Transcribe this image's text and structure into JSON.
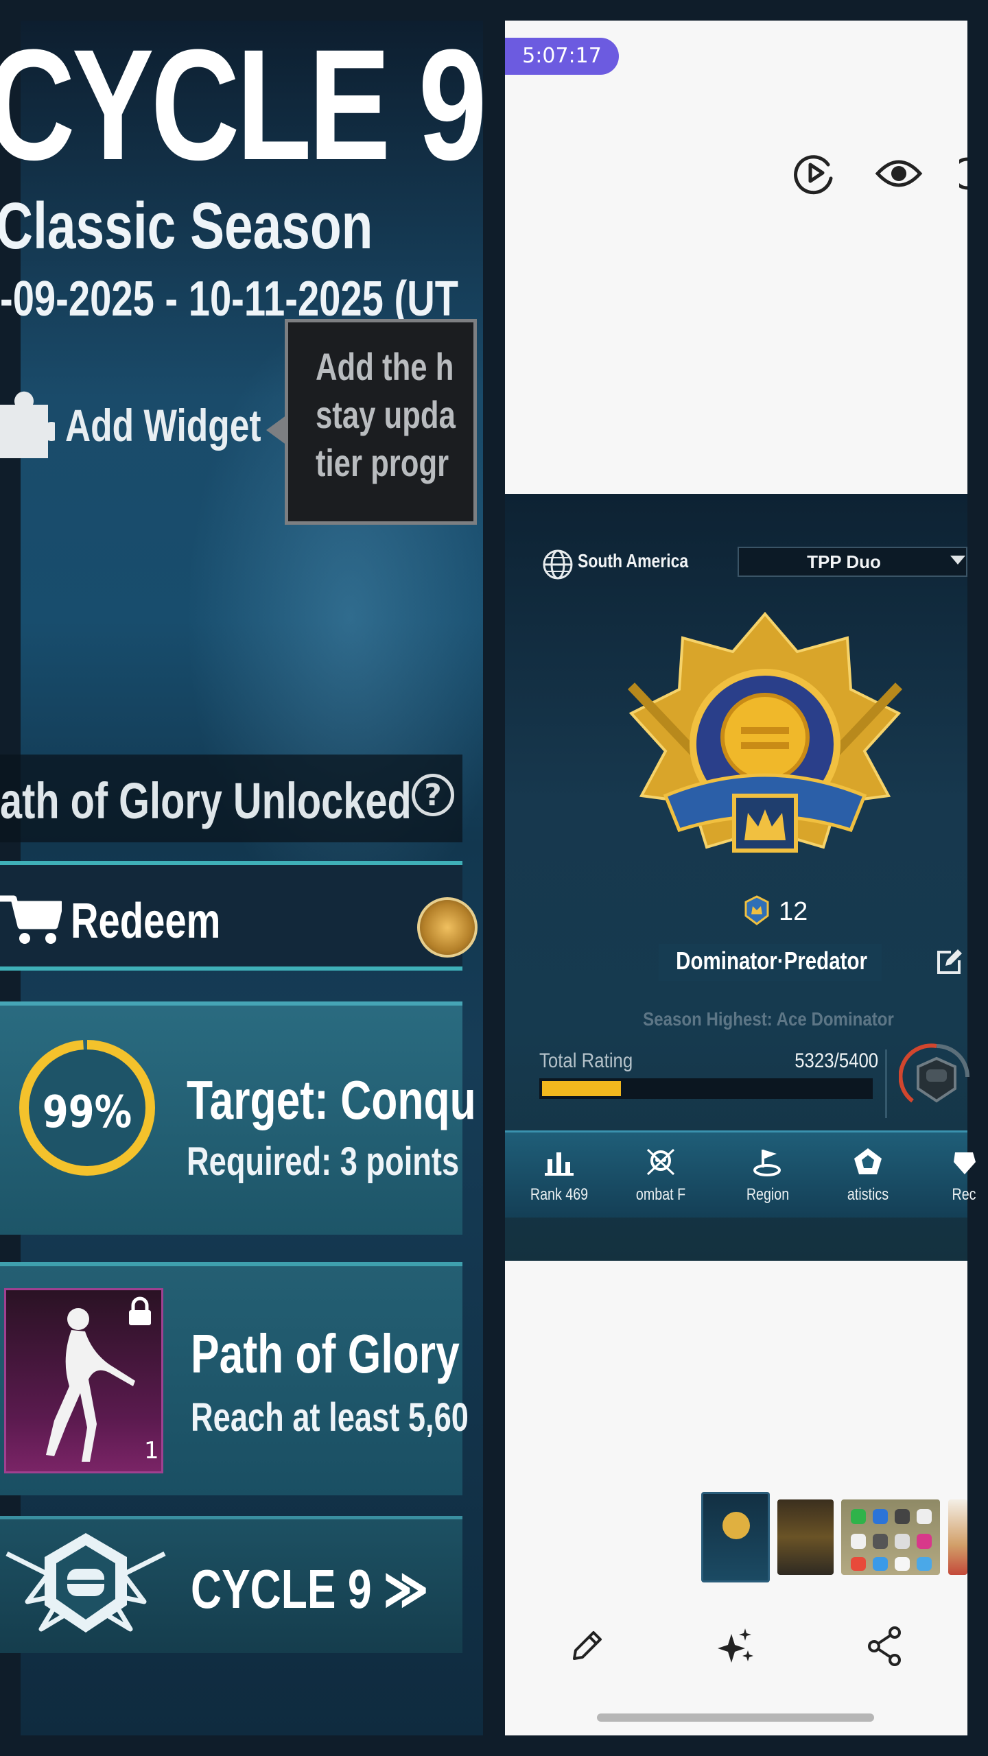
{
  "left_panel": {
    "cycle_title": "CYCLE 9",
    "season_name": "Classic Season",
    "season_dates": "-09-2025 - 10-11-2025 (UT",
    "widget_label": "Add Widget",
    "tooltip_lines": [
      "Add the h",
      "stay upda",
      "tier progr"
    ],
    "path_of_glory_text": "ath of Glory Unlocked",
    "help_glyph": "?",
    "redeem_label": "Redeem",
    "target": {
      "progress_percent": 99,
      "progress_label": "99%",
      "title": "Target: Conqu",
      "subtitle": "Required: 3 points"
    },
    "reward": {
      "title": "Path of Glory",
      "subtitle": "Reach at least 5,60",
      "count": "1"
    },
    "footer_label": "CYCLE 9 ≫"
  },
  "right_panel": {
    "status_time": "5:07:17",
    "region_label": "South America",
    "mode_label": "TPP Duo",
    "tier_number": "12",
    "tier_name": "Dominator·Predator",
    "season_highest": "Season Highest: Ace Dominator",
    "rating_label": "Total Rating",
    "rating_value": "5323/5400",
    "rating_fraction": 0.24,
    "tabs": [
      {
        "label": "Rank 469",
        "icon": "bar-chart-icon"
      },
      {
        "label": "ombat F",
        "icon": "combat-skull-icon"
      },
      {
        "label": "Region",
        "icon": "region-flag-icon"
      },
      {
        "label": "atistics",
        "icon": "statistics-pentagon-icon"
      },
      {
        "label": "Rec",
        "icon": "record-icon"
      }
    ],
    "actions": [
      "edit-icon",
      "ai-sparkle-icon",
      "share-icon"
    ]
  },
  "colors": {
    "accent_purple": "#6c5be0",
    "progress_gold": "#f2b81e",
    "teal_border": "#3fb0b8"
  }
}
